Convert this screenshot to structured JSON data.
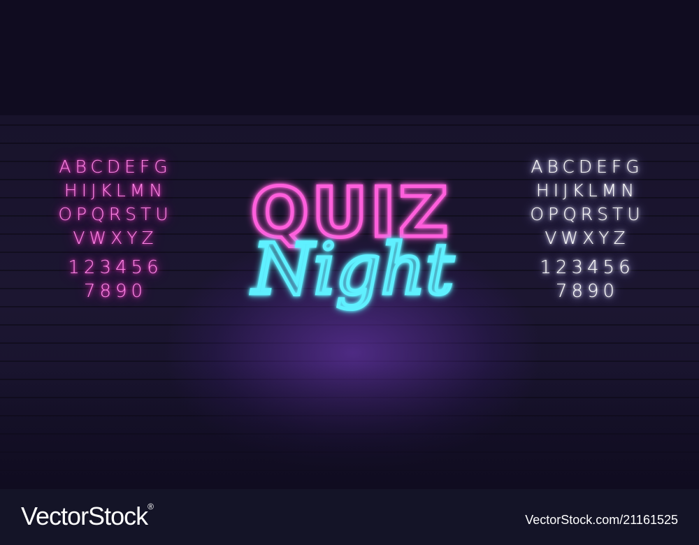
{
  "title": {
    "line1": "QUIZ",
    "line2": "Night"
  },
  "alphabet_left": {
    "letters": [
      "ABCDEFG",
      "HIJKLMN",
      "OPQRSTU",
      "VWXYZ"
    ],
    "digits": [
      "123456",
      "7890"
    ]
  },
  "alphabet_right": {
    "letters": [
      "ABCDEFG",
      "HIJKLMN",
      "OPQRSTU",
      "VWXYZ"
    ],
    "digits": [
      "123456",
      "7890"
    ]
  },
  "footer": {
    "logo": "VectorStock",
    "registered": "®",
    "image_id": "VectorStock.com/21161525"
  },
  "colors": {
    "background": "#100c20",
    "neon_pink": "#ff3fd0",
    "neon_cyan": "#3ee9ff",
    "neon_white": "#ffffff",
    "footer_band": "#141427"
  }
}
